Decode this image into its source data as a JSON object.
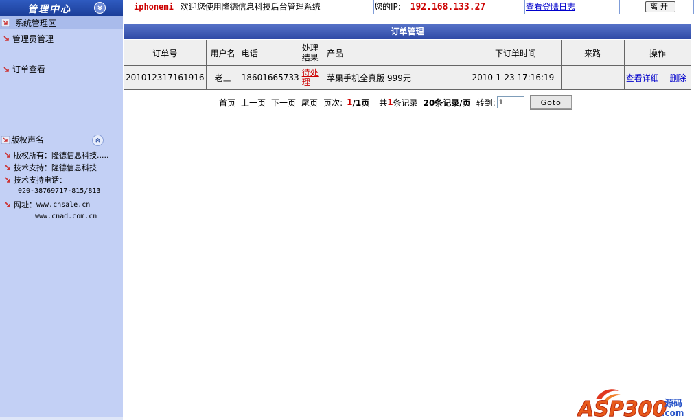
{
  "sidebar": {
    "header_title": "管理中心",
    "section_system": "系统管理区",
    "menu": [
      {
        "label": "管理员管理"
      },
      {
        "label": "订单查看"
      }
    ],
    "section_copyright": "版权声名",
    "copyright_lines": [
      "版权所有：隆德信息科技.....",
      "技术支持：隆德信息科技",
      "技术支持电话："
    ],
    "phone": "020-38769717-815/813",
    "website_label": "网址：",
    "website_1": "www.cnsale.cn",
    "website_2": "www.cnad.com.cn"
  },
  "topbar": {
    "username": "iphonemi",
    "welcome": "欢迎您使用隆德信息科技后台管理系统",
    "ip_label": "您的IP:",
    "ip_value": "192.168.133.27",
    "login_log_link": "查看登陆日志",
    "leave_button": "离开"
  },
  "panel": {
    "title": "订单管理",
    "columns": [
      "订单号",
      "用户名",
      "电话",
      "处理结果",
      "产品",
      "下订单时间",
      "来路",
      "操作"
    ],
    "rows": [
      {
        "order_no": "201012317161916",
        "username": "老三",
        "phone": "18601665733",
        "status": "待处理",
        "product": "苹果手机全真版 999元",
        "order_time": "2010-1-23 17:16:19",
        "source": "",
        "action_view": "查看详细",
        "action_delete": "删除"
      }
    ]
  },
  "pager": {
    "first": "首页",
    "prev": "上一页",
    "next": "下一页",
    "last": "尾页",
    "page_label": "页次:",
    "current_page": "1",
    "total_pages": "/1页",
    "total_prefix": "共",
    "total_count": "1",
    "total_suffix": "条记录",
    "per_page": "20条记录/页",
    "goto_label": "转到:",
    "goto_value": "1",
    "goto_button": "Goto"
  },
  "watermark": {
    "text": "ASP300",
    "suffix": "源码",
    "domain": ".com"
  },
  "colors": {
    "sidebar_bg": "#c3d0f5",
    "header_blue": "#1b3d97",
    "panel_head": "#2f4aa6",
    "accent_red": "#cc0000",
    "link_blue": "#0000cc"
  }
}
